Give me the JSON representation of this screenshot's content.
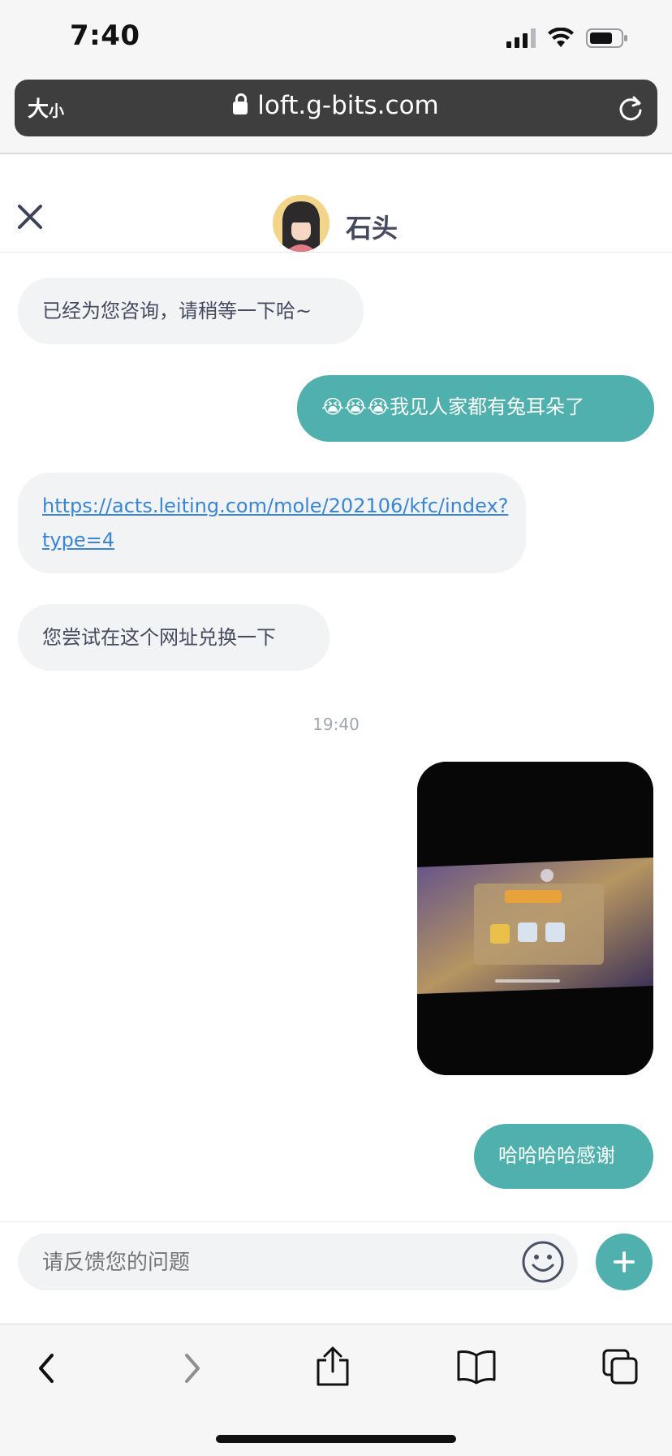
{
  "status_bar": {
    "time": "7:40"
  },
  "browser": {
    "text_size": "大",
    "text_size_small": "小",
    "url": "loft.g-bits.com"
  },
  "chat_header": {
    "agent_name": "石头"
  },
  "messages": [
    {
      "from": "agent",
      "text": "已经为您咨询，请稍等一下哈~"
    },
    {
      "from": "user",
      "text": "😭😭😭我见人家都有兔耳朵了"
    },
    {
      "from": "agent",
      "link_line1": "https://acts.leiting.com/mole/202106/kfc/index?",
      "link_line2": "type=4"
    },
    {
      "from": "agent",
      "text": "您尝试在这个网址兑换一下"
    },
    {
      "from": "user",
      "text": "哈哈哈哈感谢"
    }
  ],
  "timestamp": "19:40",
  "input": {
    "placeholder": "请反馈您的问题"
  },
  "colors": {
    "accent": "#4fb0ad",
    "agent_bubble": "#f2f3f5",
    "agent_text": "#464a5e",
    "link": "#3a86d4"
  }
}
